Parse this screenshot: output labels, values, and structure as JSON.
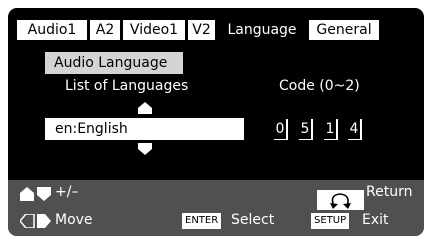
{
  "tabs": [
    {
      "label": "Audio1",
      "active": false
    },
    {
      "label": "A2",
      "active": false
    },
    {
      "label": "Video1",
      "active": false
    },
    {
      "label": "V2",
      "active": false
    },
    {
      "label": "Language",
      "active": true
    },
    {
      "label": "General",
      "active": false
    }
  ],
  "section": {
    "title": "Audio Language",
    "list_label": "List of Languages",
    "code_label": "Code (0~2)"
  },
  "language_field": {
    "value": "en:English"
  },
  "code_digits": [
    "0",
    "5",
    "1",
    "4"
  ],
  "footer": {
    "adjust_label": "+/–",
    "move_label": "Move",
    "enter_key": "ENTER",
    "select_label": "Select",
    "return_label": "Return",
    "setup_key": "SETUP",
    "exit_label": "Exit"
  },
  "icons": [
    "up-arrow-icon",
    "down-arrow-icon",
    "up-down-arrows-icon",
    "left-right-arrows-icon",
    "return-arrow-icon"
  ],
  "colors": {
    "background": "#000000",
    "footer": "#505050",
    "highlight": "#d4d4d4",
    "text": "#ffffff"
  }
}
